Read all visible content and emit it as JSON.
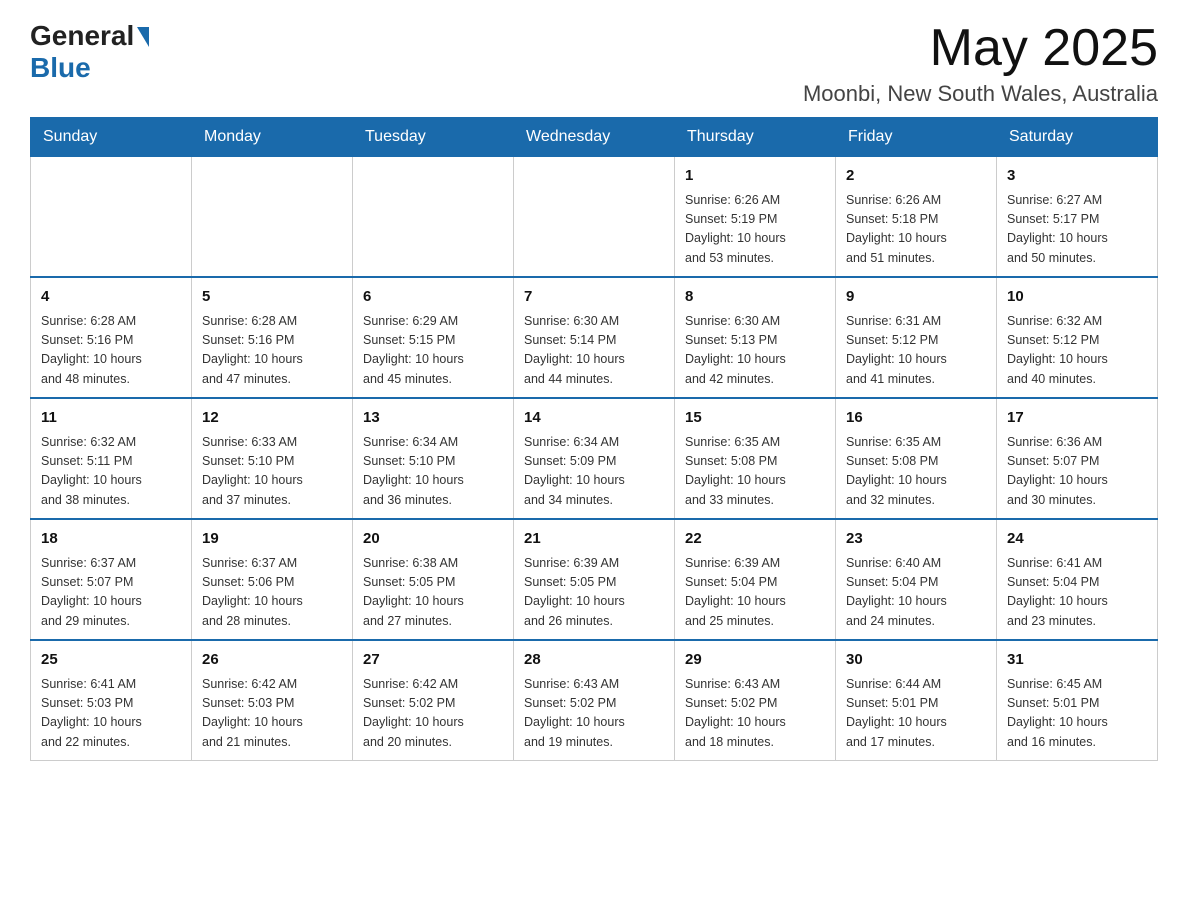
{
  "header": {
    "logo_general": "General",
    "logo_blue": "Blue",
    "month_year": "May 2025",
    "location": "Moonbi, New South Wales, Australia"
  },
  "days_of_week": [
    "Sunday",
    "Monday",
    "Tuesday",
    "Wednesday",
    "Thursday",
    "Friday",
    "Saturday"
  ],
  "weeks": [
    [
      {
        "day": "",
        "info": ""
      },
      {
        "day": "",
        "info": ""
      },
      {
        "day": "",
        "info": ""
      },
      {
        "day": "",
        "info": ""
      },
      {
        "day": "1",
        "info": "Sunrise: 6:26 AM\nSunset: 5:19 PM\nDaylight: 10 hours\nand 53 minutes."
      },
      {
        "day": "2",
        "info": "Sunrise: 6:26 AM\nSunset: 5:18 PM\nDaylight: 10 hours\nand 51 minutes."
      },
      {
        "day": "3",
        "info": "Sunrise: 6:27 AM\nSunset: 5:17 PM\nDaylight: 10 hours\nand 50 minutes."
      }
    ],
    [
      {
        "day": "4",
        "info": "Sunrise: 6:28 AM\nSunset: 5:16 PM\nDaylight: 10 hours\nand 48 minutes."
      },
      {
        "day": "5",
        "info": "Sunrise: 6:28 AM\nSunset: 5:16 PM\nDaylight: 10 hours\nand 47 minutes."
      },
      {
        "day": "6",
        "info": "Sunrise: 6:29 AM\nSunset: 5:15 PM\nDaylight: 10 hours\nand 45 minutes."
      },
      {
        "day": "7",
        "info": "Sunrise: 6:30 AM\nSunset: 5:14 PM\nDaylight: 10 hours\nand 44 minutes."
      },
      {
        "day": "8",
        "info": "Sunrise: 6:30 AM\nSunset: 5:13 PM\nDaylight: 10 hours\nand 42 minutes."
      },
      {
        "day": "9",
        "info": "Sunrise: 6:31 AM\nSunset: 5:12 PM\nDaylight: 10 hours\nand 41 minutes."
      },
      {
        "day": "10",
        "info": "Sunrise: 6:32 AM\nSunset: 5:12 PM\nDaylight: 10 hours\nand 40 minutes."
      }
    ],
    [
      {
        "day": "11",
        "info": "Sunrise: 6:32 AM\nSunset: 5:11 PM\nDaylight: 10 hours\nand 38 minutes."
      },
      {
        "day": "12",
        "info": "Sunrise: 6:33 AM\nSunset: 5:10 PM\nDaylight: 10 hours\nand 37 minutes."
      },
      {
        "day": "13",
        "info": "Sunrise: 6:34 AM\nSunset: 5:10 PM\nDaylight: 10 hours\nand 36 minutes."
      },
      {
        "day": "14",
        "info": "Sunrise: 6:34 AM\nSunset: 5:09 PM\nDaylight: 10 hours\nand 34 minutes."
      },
      {
        "day": "15",
        "info": "Sunrise: 6:35 AM\nSunset: 5:08 PM\nDaylight: 10 hours\nand 33 minutes."
      },
      {
        "day": "16",
        "info": "Sunrise: 6:35 AM\nSunset: 5:08 PM\nDaylight: 10 hours\nand 32 minutes."
      },
      {
        "day": "17",
        "info": "Sunrise: 6:36 AM\nSunset: 5:07 PM\nDaylight: 10 hours\nand 30 minutes."
      }
    ],
    [
      {
        "day": "18",
        "info": "Sunrise: 6:37 AM\nSunset: 5:07 PM\nDaylight: 10 hours\nand 29 minutes."
      },
      {
        "day": "19",
        "info": "Sunrise: 6:37 AM\nSunset: 5:06 PM\nDaylight: 10 hours\nand 28 minutes."
      },
      {
        "day": "20",
        "info": "Sunrise: 6:38 AM\nSunset: 5:05 PM\nDaylight: 10 hours\nand 27 minutes."
      },
      {
        "day": "21",
        "info": "Sunrise: 6:39 AM\nSunset: 5:05 PM\nDaylight: 10 hours\nand 26 minutes."
      },
      {
        "day": "22",
        "info": "Sunrise: 6:39 AM\nSunset: 5:04 PM\nDaylight: 10 hours\nand 25 minutes."
      },
      {
        "day": "23",
        "info": "Sunrise: 6:40 AM\nSunset: 5:04 PM\nDaylight: 10 hours\nand 24 minutes."
      },
      {
        "day": "24",
        "info": "Sunrise: 6:41 AM\nSunset: 5:04 PM\nDaylight: 10 hours\nand 23 minutes."
      }
    ],
    [
      {
        "day": "25",
        "info": "Sunrise: 6:41 AM\nSunset: 5:03 PM\nDaylight: 10 hours\nand 22 minutes."
      },
      {
        "day": "26",
        "info": "Sunrise: 6:42 AM\nSunset: 5:03 PM\nDaylight: 10 hours\nand 21 minutes."
      },
      {
        "day": "27",
        "info": "Sunrise: 6:42 AM\nSunset: 5:02 PM\nDaylight: 10 hours\nand 20 minutes."
      },
      {
        "day": "28",
        "info": "Sunrise: 6:43 AM\nSunset: 5:02 PM\nDaylight: 10 hours\nand 19 minutes."
      },
      {
        "day": "29",
        "info": "Sunrise: 6:43 AM\nSunset: 5:02 PM\nDaylight: 10 hours\nand 18 minutes."
      },
      {
        "day": "30",
        "info": "Sunrise: 6:44 AM\nSunset: 5:01 PM\nDaylight: 10 hours\nand 17 minutes."
      },
      {
        "day": "31",
        "info": "Sunrise: 6:45 AM\nSunset: 5:01 PM\nDaylight: 10 hours\nand 16 minutes."
      }
    ]
  ]
}
